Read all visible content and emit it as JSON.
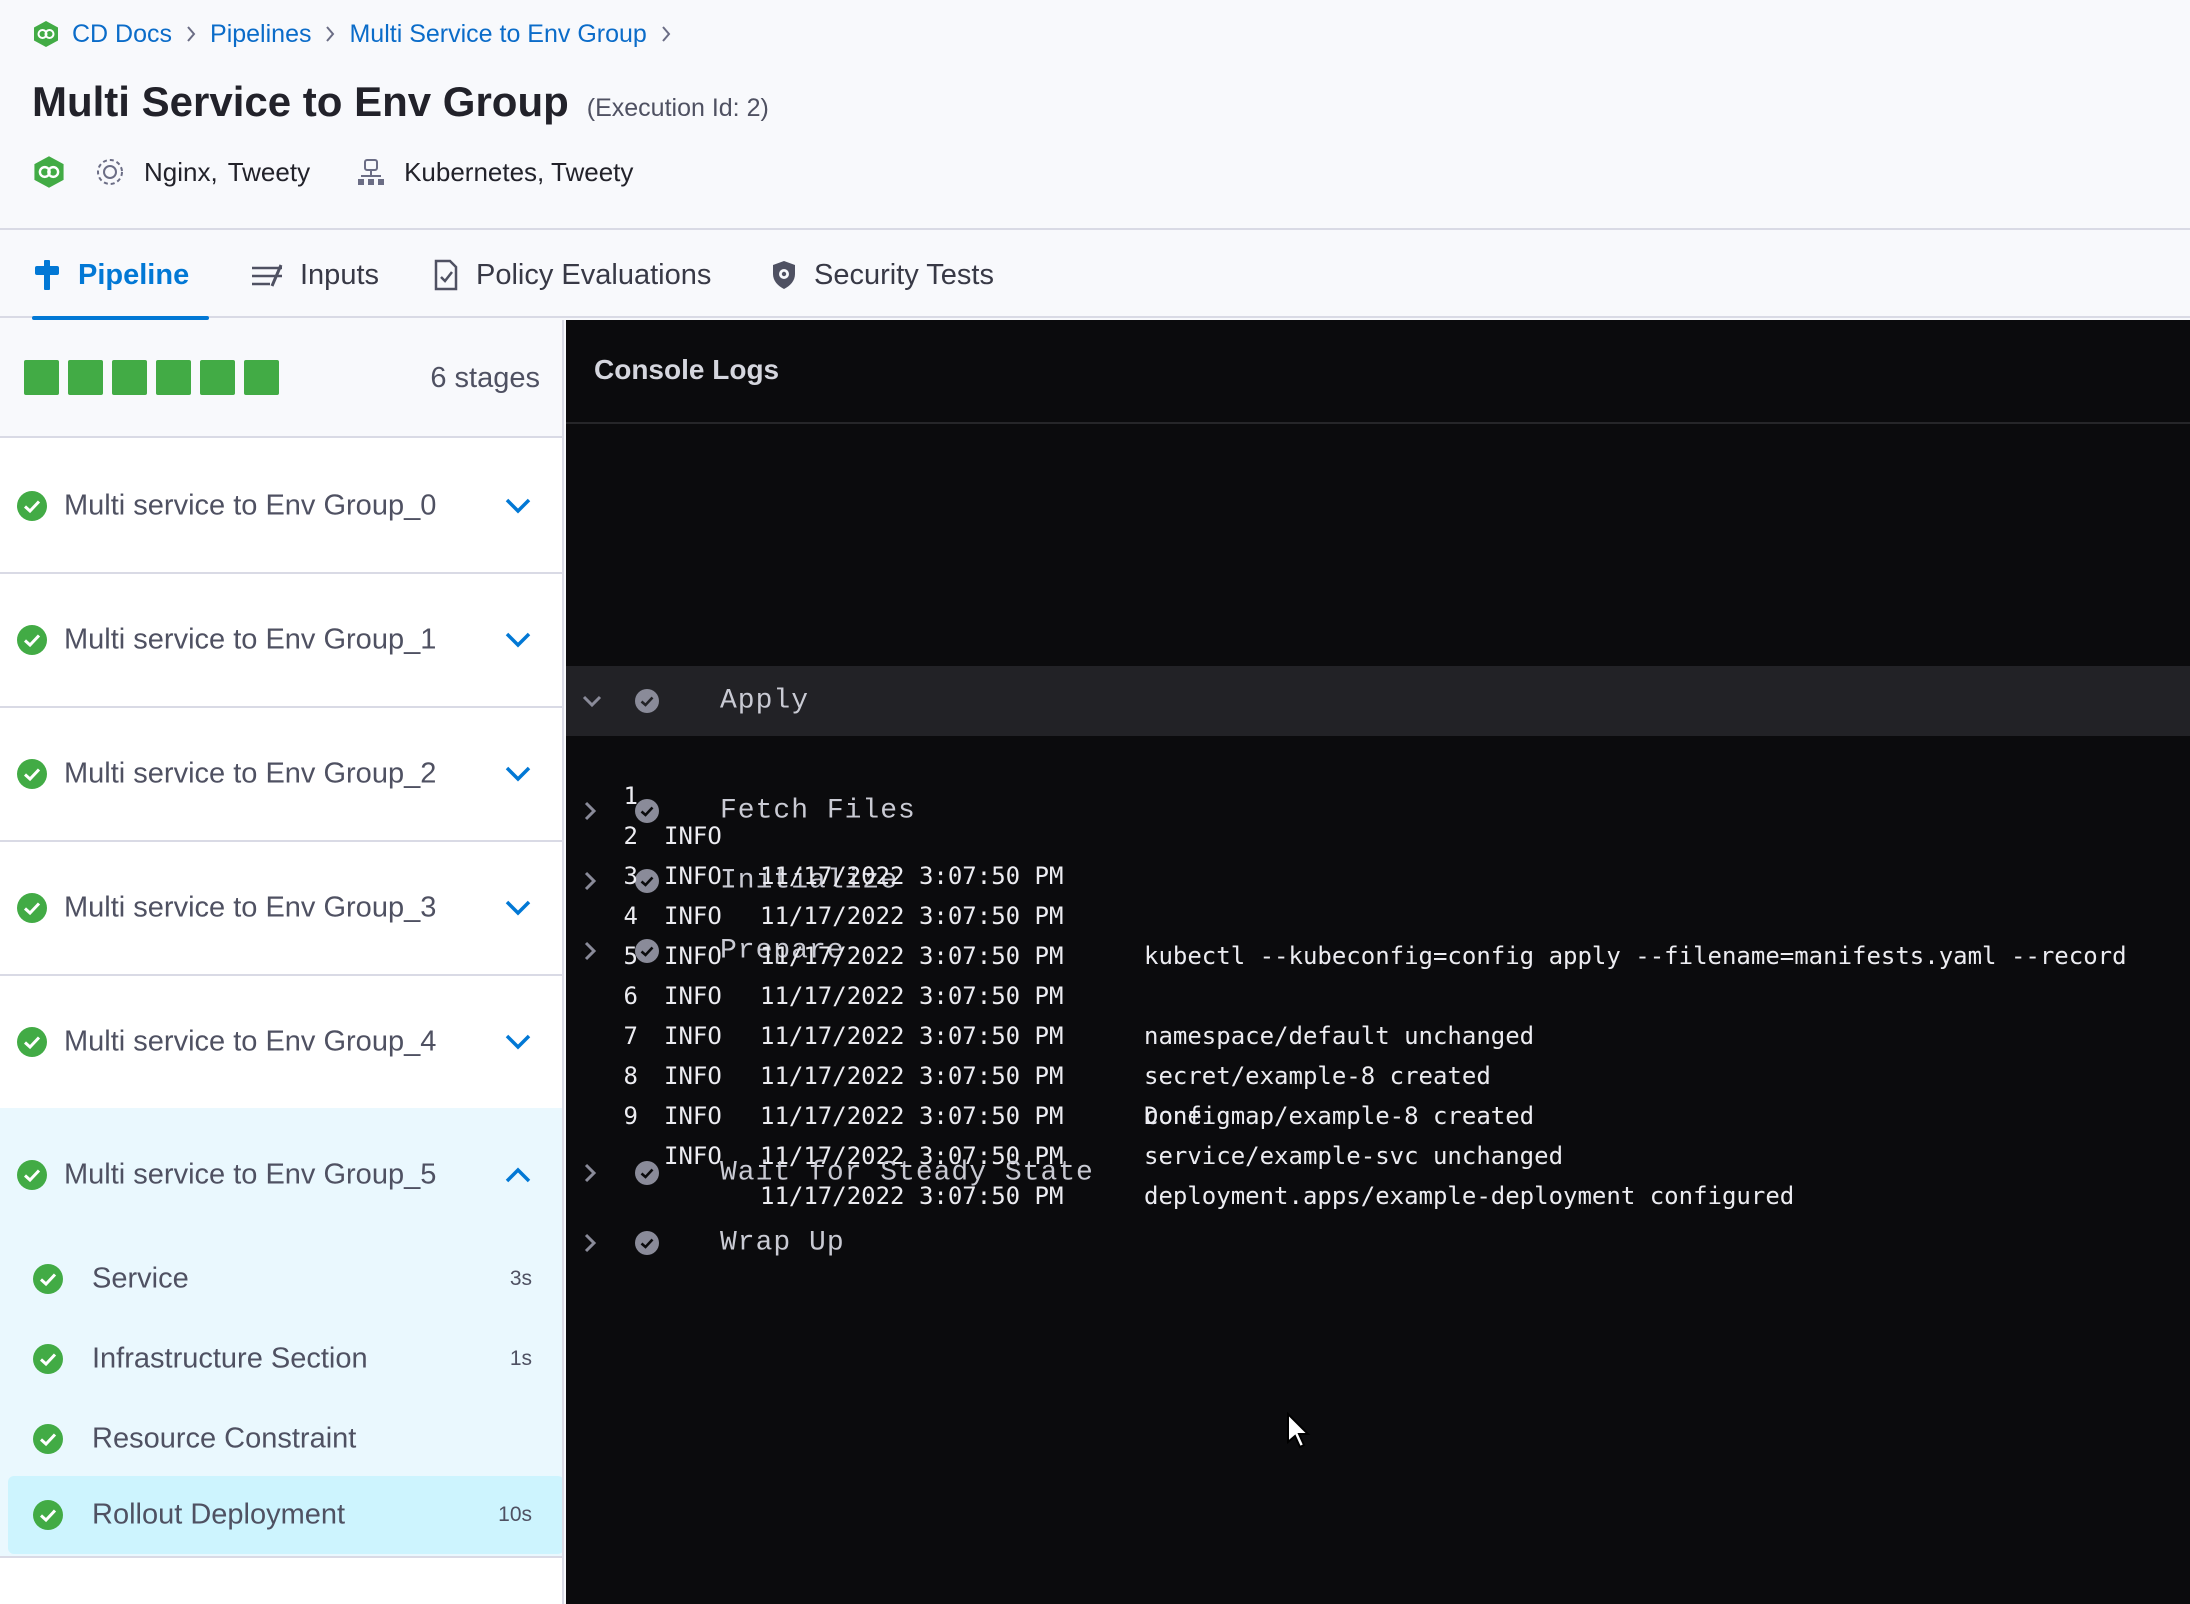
{
  "breadcrumb": {
    "items": [
      "CD Docs",
      "Pipelines",
      "Multi Service to Env Group"
    ]
  },
  "header": {
    "title": "Multi Service to Env Group",
    "execution_id": "(Execution Id: 2)",
    "services": [
      "Nginx,",
      "Tweety"
    ],
    "infrastructure": "Kubernetes, Tweety"
  },
  "tabs": [
    {
      "label": "Pipeline",
      "icon": "pipeline-icon",
      "active": true
    },
    {
      "label": "Inputs",
      "icon": "inputs-icon",
      "active": false
    },
    {
      "label": "Policy Evaluations",
      "icon": "policy-icon",
      "active": false
    },
    {
      "label": "Security Tests",
      "icon": "security-icon",
      "active": false
    }
  ],
  "stages_summary": {
    "count_label": "6 stages",
    "status_color": "#42ab45"
  },
  "stages": [
    {
      "name": "Multi service to Env Group_0",
      "status": "success"
    },
    {
      "name": "Multi service to Env Group_1",
      "status": "success"
    },
    {
      "name": "Multi service to Env Group_2",
      "status": "success"
    },
    {
      "name": "Multi service to Env Group_3",
      "status": "success"
    },
    {
      "name": "Multi service to Env Group_4",
      "status": "success"
    },
    {
      "name": "Multi service to Env Group_5",
      "status": "success",
      "expanded": true
    }
  ],
  "steps": [
    {
      "name": "Service",
      "duration": "3s"
    },
    {
      "name": "Infrastructure Section",
      "duration": "1s"
    },
    {
      "name": "Resource Constraint",
      "duration": ""
    },
    {
      "name": "Rollout Deployment",
      "duration": "10s",
      "selected": true
    }
  ],
  "console": {
    "title": "Console Logs",
    "sections": [
      {
        "name": "Fetch Files",
        "open": false
      },
      {
        "name": "Initialize",
        "open": false
      },
      {
        "name": "Prepare",
        "open": false
      },
      {
        "name": "Apply",
        "open": true
      },
      {
        "name": "Wait for Steady State",
        "open": false
      },
      {
        "name": "Wrap Up",
        "open": false
      }
    ],
    "lines": [
      {
        "n": "1",
        "level": "INFO",
        "ts": "11/17/2022 3:07:50 PM",
        "msg": ""
      },
      {
        "n": "2",
        "level": "INFO",
        "ts": "11/17/2022 3:07:50 PM",
        "msg": "kubectl --kubeconfig=config apply --filename=manifests.yaml --record"
      },
      {
        "n": "3",
        "level": "INFO",
        "ts": "11/17/2022 3:07:50 PM",
        "msg": ""
      },
      {
        "n": "4",
        "level": "INFO",
        "ts": "11/17/2022 3:07:50 PM",
        "msg": "namespace/default unchanged"
      },
      {
        "n": "5",
        "level": "INFO",
        "ts": "11/17/2022 3:07:50 PM",
        "msg": "secret/example-8 created"
      },
      {
        "n": "6",
        "level": "INFO",
        "ts": "11/17/2022 3:07:50 PM",
        "msg": "configmap/example-8 created"
      },
      {
        "n": "7",
        "level": "INFO",
        "ts": "11/17/2022 3:07:50 PM",
        "msg": "service/example-svc unchanged"
      },
      {
        "n": "8",
        "level": "INFO",
        "ts": "11/17/2022 3:07:50 PM",
        "msg": "deployment.apps/example-deployment configured"
      },
      {
        "n": "9",
        "level": "INFO",
        "ts": "11/17/2022 3:07:50 PM",
        "msg": ""
      }
    ],
    "trailing_text": "Done."
  },
  "colors": {
    "accent": "#0278d5",
    "success": "#42ab45",
    "console_bg": "#0b0b0d"
  }
}
